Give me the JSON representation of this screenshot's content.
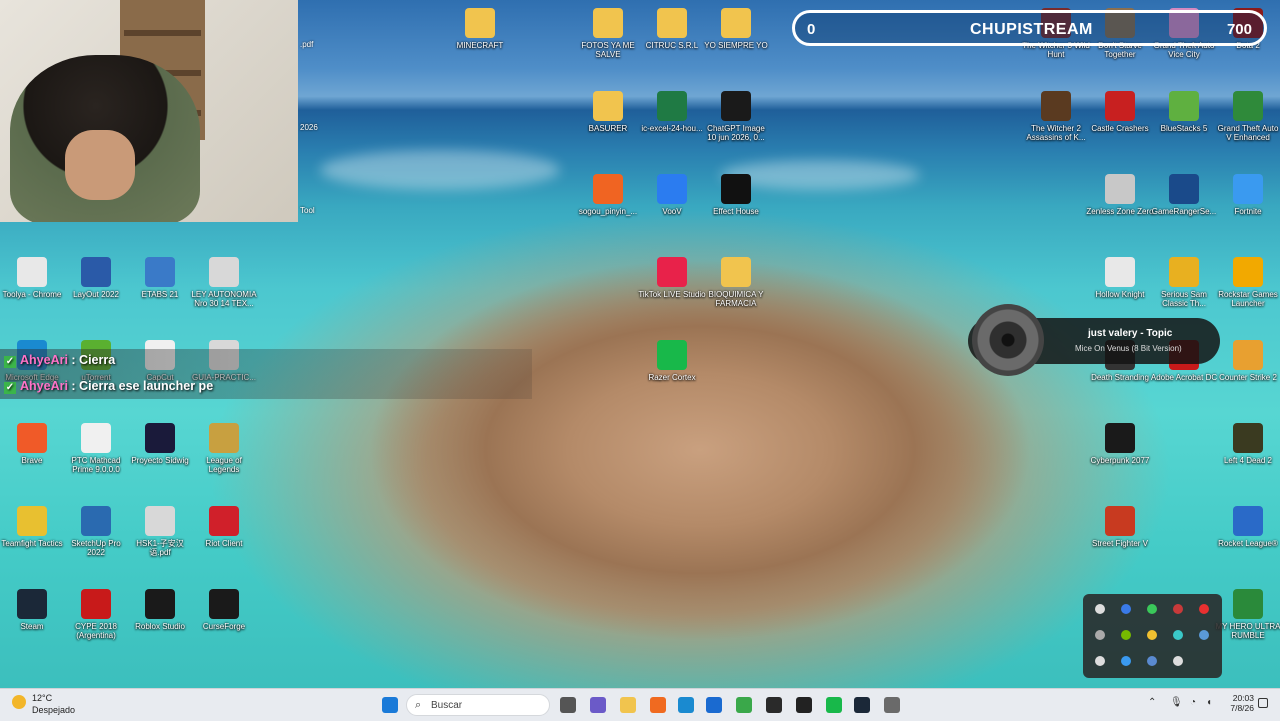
{
  "overlay": {
    "score_left": "0",
    "stream_title": "CHUPISTREAM",
    "score_right": "700"
  },
  "chat": [
    {
      "user": "AhyeAri",
      "sep": " : ",
      "text": "Cierra"
    },
    {
      "user": "AhyeAri",
      "sep": " : ",
      "text": "Cierra ese launcher pe"
    }
  ],
  "now_playing": {
    "title": "just valery - Topic",
    "subtitle": "Mice On Venus (8 Bit Version)"
  },
  "desktop_icons": [
    {
      "label": "MINECRAFT",
      "icon": "folder-icon",
      "color": "#f1c44e"
    },
    {
      "label": "FOTOS YA ME SALVE",
      "icon": "folder-icon",
      "color": "#f1c44e"
    },
    {
      "label": "CITRUC S.R.L",
      "icon": "folder-icon",
      "color": "#f1c44e"
    },
    {
      "label": "YO SIEMPRE YO",
      "icon": "folder-icon",
      "color": "#f1c44e"
    },
    {
      "label": "BASURER",
      "icon": "folder-icon",
      "color": "#f1c44e"
    },
    {
      "label": "ic-excel-24-hou...",
      "icon": "excel-icon",
      "color": "#1f7a44"
    },
    {
      "label": "ChatGPT Image 10 jun 2026, 0...",
      "icon": "image-icon",
      "color": "#1a1a1a"
    },
    {
      "label": "sogou_pinyin_...",
      "icon": "sogou-icon",
      "color": "#f06422"
    },
    {
      "label": "VooV",
      "icon": "voov-icon",
      "color": "#2b7cf0"
    },
    {
      "label": "Effect House",
      "icon": "effect-house-icon",
      "color": "#111111"
    },
    {
      "label": "TikTok LIVE Studio",
      "icon": "tiktok-icon",
      "color": "#e8224a"
    },
    {
      "label": "BIOQUIMICA Y FARMACIA",
      "icon": "folder-icon",
      "color": "#f1c44e"
    },
    {
      "label": "Razer Cortex",
      "icon": "razer-icon",
      "color": "#18b84a"
    },
    {
      "label": "The Witcher 3 Wild Hunt",
      "icon": "witcher3-icon",
      "color": "#7a2b2b"
    },
    {
      "label": "Don't Starve Together",
      "icon": "dst-icon",
      "color": "#8b6f4e"
    },
    {
      "label": "Grand Theft Auto Vice City",
      "icon": "gtavc-icon",
      "color": "#d68ac0"
    },
    {
      "label": "Dota 2",
      "icon": "dota-icon",
      "color": "#8b1a1a"
    },
    {
      "label": "The Witcher 2 Assassins of K...",
      "icon": "witcher2-icon",
      "color": "#5a3a20"
    },
    {
      "label": "Castle Crashers",
      "icon": "castle-crashers-icon",
      "color": "#c82020"
    },
    {
      "label": "BlueStacks 5",
      "icon": "bluestacks-icon",
      "color": "#5fb040"
    },
    {
      "label": "Grand Theft Auto V Enhanced",
      "icon": "gtav-icon",
      "color": "#2f8a3a"
    },
    {
      "label": "Zenless Zone Zero",
      "icon": "zzz-icon",
      "color": "#c8c8c8"
    },
    {
      "label": "GameRangerSe...",
      "icon": "gameranger-icon",
      "color": "#1a4a8a"
    },
    {
      "label": "Fortnite",
      "icon": "fortnite-icon",
      "color": "#3a9af0"
    },
    {
      "label": "Hollow Knight",
      "icon": "hollow-knight-icon",
      "color": "#e8e8e8"
    },
    {
      "label": "Serious Sam Classic Th...",
      "icon": "serious-sam-icon",
      "color": "#e8b020"
    },
    {
      "label": "Rockstar Games Launcher",
      "icon": "rockstar-icon",
      "color": "#f2a900"
    },
    {
      "label": "Death Stranding",
      "icon": "death-stranding-icon",
      "color": "#333333"
    },
    {
      "label": "Adobe Acrobat DC",
      "icon": "acrobat-icon",
      "color": "#c81a1a"
    },
    {
      "label": "Counter Strike 2",
      "icon": "cs2-icon",
      "color": "#e8a030"
    },
    {
      "label": "Cyberpunk 2077",
      "icon": "cyberpunk-icon",
      "color": "#1a1a1a"
    },
    {
      "label": "Left 4 Dead 2",
      "icon": "l4d2-icon",
      "color": "#3a3a20"
    },
    {
      "label": "Street Fighter V",
      "icon": "sfv-icon",
      "color": "#c83a20"
    },
    {
      "label": "Rocket League®",
      "icon": "rocket-league-icon",
      "color": "#2a6ac8"
    },
    {
      "label": "MY HERO ULTRA RUMBLE",
      "icon": "mhur-icon",
      "color": "#2a8a3a"
    },
    {
      "label": "Toolya - Chrome",
      "icon": "chrome-icon",
      "color": "#e8e8e8"
    },
    {
      "label": "LayOut 2022",
      "icon": "layout-icon",
      "color": "#2a5aa8"
    },
    {
      "label": "ETABS 21",
      "icon": "etabs-icon",
      "color": "#3a7ac8"
    },
    {
      "label": "LEY AUTONOMIA Nro 30 14 TEX...",
      "icon": "pdf-icon",
      "color": "#d8d8d8"
    },
    {
      "label": "Microsoft Edge",
      "icon": "edge-icon",
      "color": "#1a8ad0"
    },
    {
      "label": "uTorrent",
      "icon": "utorrent-icon",
      "color": "#5ab030"
    },
    {
      "label": "CapCut",
      "icon": "capcut-icon",
      "color": "#f0f0f0"
    },
    {
      "label": "GUIA-PRACTIC...",
      "icon": "pdf-icon",
      "color": "#d8d8d8"
    },
    {
      "label": "Brave",
      "icon": "brave-icon",
      "color": "#f05a28"
    },
    {
      "label": "PTC Mathcad Prime 9.0.0.0",
      "icon": "mathcad-icon",
      "color": "#f0f0f0"
    },
    {
      "label": "Proyecto Sidwig",
      "icon": "image-icon",
      "color": "#1a1a3a"
    },
    {
      "label": "League of Legends",
      "icon": "lol-icon",
      "color": "#c8a040"
    },
    {
      "label": "Teamfight Tactics",
      "icon": "tft-icon",
      "color": "#e8c030"
    },
    {
      "label": "SketchUp Pro 2022",
      "icon": "sketchup-icon",
      "color": "#2a6ab0"
    },
    {
      "label": "HSK1-子安汉语.pdf",
      "icon": "pdf-icon",
      "color": "#d8d8d8"
    },
    {
      "label": "Riot Client",
      "icon": "riot-icon",
      "color": "#d0202a"
    },
    {
      "label": "Steam",
      "icon": "steam-icon",
      "color": "#1b2838"
    },
    {
      "label": "CYPE 2018 (Argentina)",
      "icon": "cype-icon",
      "color": "#c81a1a"
    },
    {
      "label": "Roblox Studio",
      "icon": "roblox-icon",
      "color": "#1a1a1a"
    },
    {
      "label": "CurseForge",
      "icon": "curseforge-icon",
      "color": "#1a1a1a"
    }
  ],
  "partial_icons": {
    "top": ".pdf",
    "mid": "2026",
    "low": "Tool"
  },
  "taskbar": {
    "weather_temp": "12°C",
    "weather_desc": "Despejado",
    "search_placeholder": "Buscar",
    "time": "20:03",
    "date": "7/8/26",
    "apps": [
      {
        "name": "start-icon",
        "color": "#1a7ad8"
      },
      {
        "name": "task-view-icon",
        "color": "#555555"
      },
      {
        "name": "teams-icon",
        "color": "#6b5ac8"
      },
      {
        "name": "file-explorer-icon",
        "color": "#f1c44e"
      },
      {
        "name": "firefox-icon",
        "color": "#f06a20"
      },
      {
        "name": "edge-icon",
        "color": "#1a8ad0"
      },
      {
        "name": "mail-icon",
        "color": "#1a6ad0"
      },
      {
        "name": "chrome-icon",
        "color": "#3aa84a"
      },
      {
        "name": "obs-icon",
        "color": "#2a2a2a"
      },
      {
        "name": "epic-games-icon",
        "color": "#222222"
      },
      {
        "name": "razer-icon",
        "color": "#18b84a"
      },
      {
        "name": "steam-icon",
        "color": "#1b2838"
      },
      {
        "name": "settings-icon",
        "color": "#6a6a6a"
      }
    ]
  },
  "tray_icons": [
    {
      "name": "cursor-icon",
      "color": "#dddddd"
    },
    {
      "name": "bluetooth-icon",
      "color": "#3a7ae8"
    },
    {
      "name": "whatsapp-icon",
      "color": "#3ac85a"
    },
    {
      "name": "mic-icon",
      "color": "#c83a3a"
    },
    {
      "name": "record-icon",
      "color": "#e83030"
    },
    {
      "name": "settings-icon",
      "color": "#aaaaaa"
    },
    {
      "name": "nvidia-icon",
      "color": "#76b900"
    },
    {
      "name": "bluestacks-icon",
      "color": "#f0c030"
    },
    {
      "name": "teams-icon",
      "color": "#3ac8c8"
    },
    {
      "name": "steam-icon",
      "color": "#5a9ad8"
    },
    {
      "name": "obs-icon",
      "color": "#dddddd"
    },
    {
      "name": "onedrive-icon",
      "color": "#3a9af0"
    },
    {
      "name": "network-icon",
      "color": "#5a8ad0"
    },
    {
      "name": "epic-games-icon",
      "color": "#dddddd"
    }
  ]
}
